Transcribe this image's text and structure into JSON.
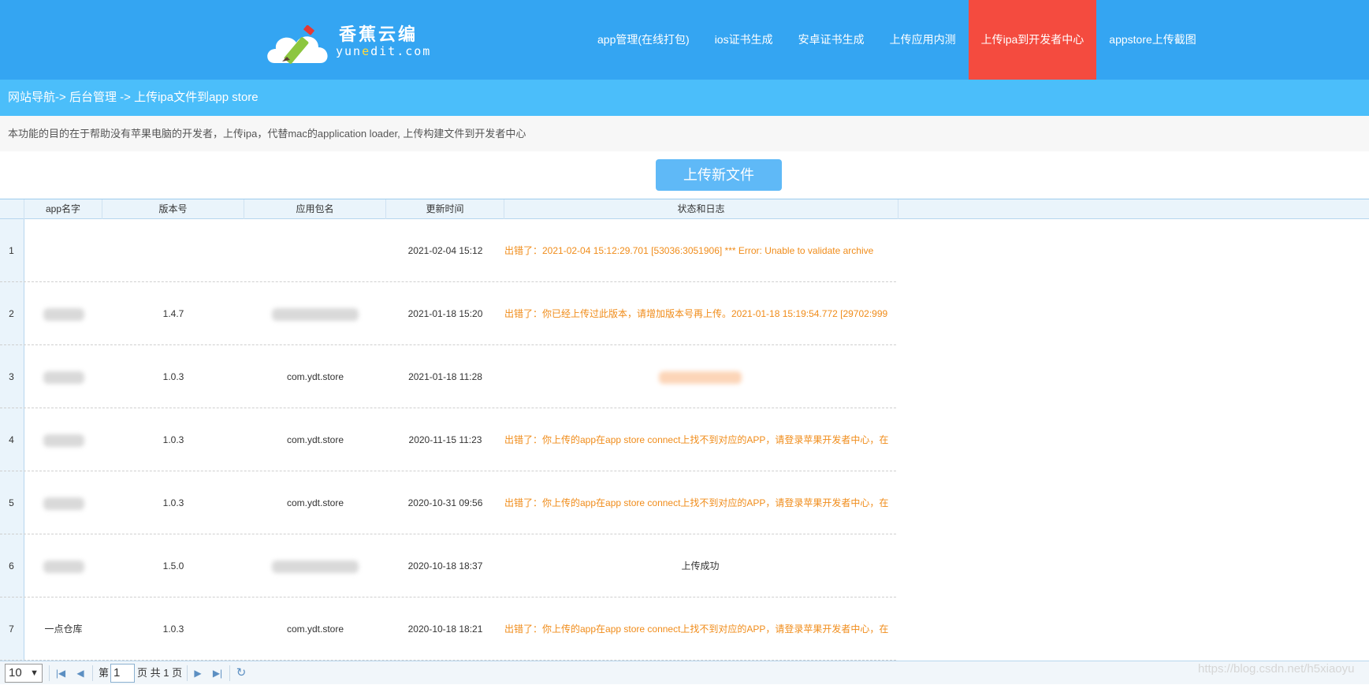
{
  "brand": {
    "title": "香蕉云编",
    "subtitle_pre": "yun",
    "subtitle_hl": "e",
    "subtitle_post": "dit.com"
  },
  "nav": [
    {
      "label": "app管理(在线打包)"
    },
    {
      "label": "ios证书生成"
    },
    {
      "label": "安卓证书生成"
    },
    {
      "label": "上传应用内测"
    },
    {
      "label": "上传ipa到开发者中心",
      "active": true
    },
    {
      "label": "appstore上传截图"
    }
  ],
  "breadcrumb": {
    "home": "网站导航",
    "sep1": "-> ",
    "admin": "后台管理",
    "sep2": " -> ",
    "current": "上传ipa文件到app store"
  },
  "description": "本功能的目的在于帮助没有苹果电脑的开发者，上传ipa，代替mac的application loader, 上传构建文件到开发者中心",
  "upload_button": "上传新文件",
  "table": {
    "headers": {
      "name": "app名字",
      "version": "版本号",
      "package": "应用包名",
      "time": "更新时间",
      "status": "状态和日志"
    },
    "rows": [
      {
        "num": "1",
        "name": "",
        "name_blur": false,
        "version": "",
        "package": "",
        "pkg_blur": false,
        "time": "2021-02-04 15:12",
        "status": "出错了：2021-02-04 15:12:29.701 [53036:3051906] *** Error: Unable to validate archive",
        "status_type": "err"
      },
      {
        "num": "2",
        "name": "",
        "name_blur": true,
        "version": "1.4.7",
        "package": "",
        "pkg_blur": true,
        "time": "2021-01-18 15:20",
        "status": "出错了：你已经上传过此版本，请增加版本号再上传。2021-01-18 15:19:54.772 [29702:999",
        "status_type": "err"
      },
      {
        "num": "3",
        "name": "",
        "name_blur": true,
        "version": "1.0.3",
        "package": "com.ydt.store",
        "pkg_blur": false,
        "time": "2021-01-18 11:28",
        "status": "",
        "status_type": "blur"
      },
      {
        "num": "4",
        "name": "",
        "name_blur": true,
        "version": "1.0.3",
        "package": "com.ydt.store",
        "pkg_blur": false,
        "time": "2020-11-15 11:23",
        "status": "出错了：你上传的app在app store connect上找不到对应的APP，请登录苹果开发者中心，在",
        "status_type": "err"
      },
      {
        "num": "5",
        "name": "",
        "name_blur": true,
        "version": "1.0.3",
        "package": "com.ydt.store",
        "pkg_blur": false,
        "time": "2020-10-31 09:56",
        "status": "出错了：你上传的app在app store connect上找不到对应的APP，请登录苹果开发者中心，在",
        "status_type": "err"
      },
      {
        "num": "6",
        "name": "",
        "name_blur": true,
        "version": "1.5.0",
        "package": "",
        "pkg_blur": true,
        "time": "2020-10-18 18:37",
        "status": "上传成功",
        "status_type": "ok"
      },
      {
        "num": "7",
        "name": "一点仓库",
        "name_blur": false,
        "version": "1.0.3",
        "package": "com.ydt.store",
        "pkg_blur": false,
        "time": "2020-10-18 18:21",
        "status": "出错了：你上传的app在app store connect上找不到对应的APP，请登录苹果开发者中心，在",
        "status_type": "err"
      }
    ]
  },
  "pager": {
    "page_size": "10",
    "page_prefix": "第",
    "page_value": "1",
    "page_suffix": "页 共 1 页"
  },
  "watermark": "https://blog.csdn.net/h5xiaoyu",
  "colors": {
    "header": "#34a5f2",
    "active_nav": "#f44b3f",
    "breadcrumb": "#4bbefa",
    "error_text": "#f08c1a",
    "button": "#5fb9f7"
  }
}
